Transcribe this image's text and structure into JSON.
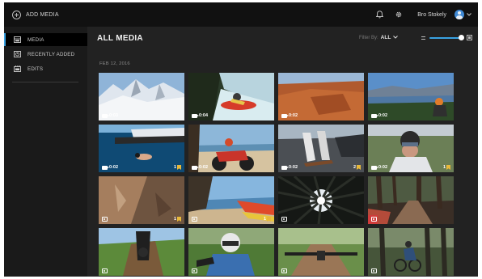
{
  "topbar": {
    "add_media_label": "ADD MEDIA",
    "user_name": "Bro Stokely",
    "chevron": "⌄"
  },
  "sidebar": {
    "items": [
      {
        "label": "MEDIA",
        "icon": "media-icon",
        "active": true
      },
      {
        "label": "RECENTLY ADDED",
        "icon": "recently-added-icon",
        "active": false
      },
      {
        "label": "EDITS",
        "icon": "edits-icon",
        "active": false
      }
    ]
  },
  "main": {
    "title": "ALL MEDIA",
    "filter_label": "Filter By:",
    "filter_value": "ALL",
    "date_label": "FEB 12, 2016"
  },
  "colors": {
    "accent": "#3aa3e3",
    "highlight": "#e8b93a",
    "app_bg": "#222222",
    "topbar_bg": "#111111",
    "sidebar_bg": "#1a1a1a"
  },
  "tiles": [
    {
      "kind": "video",
      "duration": "0:03",
      "scene": "snow-mountain",
      "hilite": null
    },
    {
      "kind": "video",
      "duration": "0:04",
      "scene": "kayak-waterfall",
      "hilite": null
    },
    {
      "kind": "video",
      "duration": "0:02",
      "scene": "red-rock-canyon",
      "hilite": null
    },
    {
      "kind": "video",
      "duration": "0:02",
      "scene": "mountain-biker-lake",
      "hilite": null
    },
    {
      "kind": "video",
      "duration": "0:02",
      "scene": "boat-ocean-swimmer",
      "hilite": "1"
    },
    {
      "kind": "video",
      "duration": "0:02",
      "scene": "beach-motocross",
      "hilite": null
    },
    {
      "kind": "video",
      "duration": "0:02",
      "scene": "skateboard-road",
      "hilite": "2"
    },
    {
      "kind": "video",
      "duration": "0:02",
      "scene": "helmet-rider-selfie",
      "hilite": "1"
    },
    {
      "kind": "photo",
      "duration": "",
      "scene": "rock-cliff",
      "hilite": "1"
    },
    {
      "kind": "photo",
      "duration": "",
      "scene": "kitesurf-beach",
      "hilite": "1"
    },
    {
      "kind": "photo",
      "duration": "",
      "scene": "forest-canopy",
      "hilite": null
    },
    {
      "kind": "photo",
      "duration": "",
      "scene": "forest-trail-red",
      "hilite": null
    },
    {
      "kind": "photo",
      "duration": "",
      "scene": "mtb-forest-downhill",
      "hilite": null
    },
    {
      "kind": "photo",
      "duration": "",
      "scene": "mtb-rider-helmet",
      "hilite": null
    },
    {
      "kind": "photo",
      "duration": "",
      "scene": "mtb-handlebars-trail",
      "hilite": null
    },
    {
      "kind": "photo",
      "duration": "",
      "scene": "mtb-jump-woods",
      "hilite": null
    }
  ]
}
